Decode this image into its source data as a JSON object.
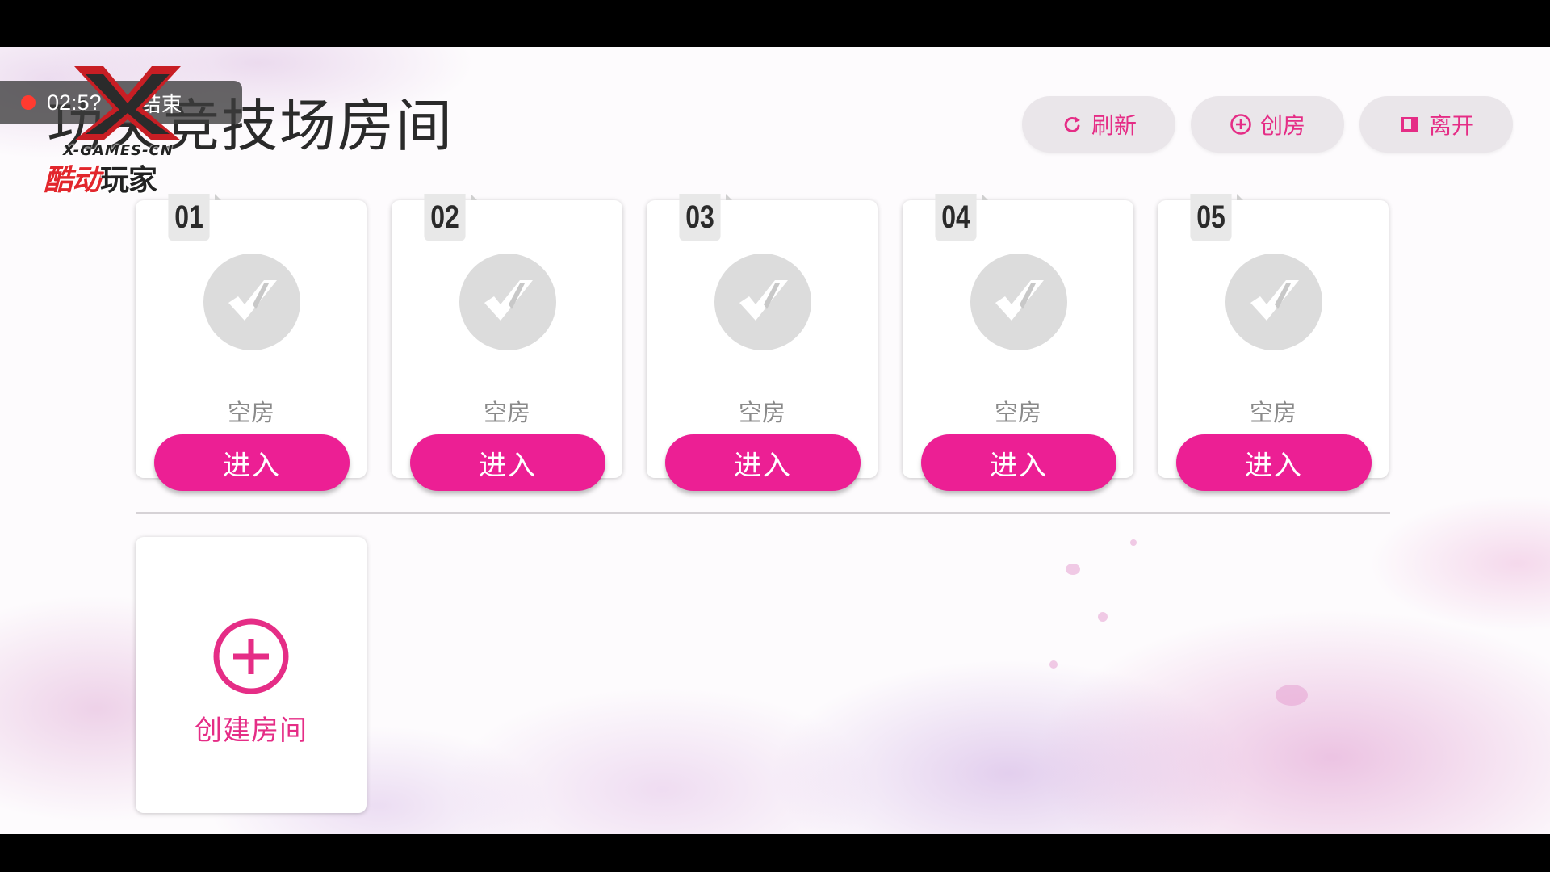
{
  "recorder": {
    "time": "02:5?",
    "end_label": "结束"
  },
  "watermark": {
    "en": "X-GAMES-CN",
    "cn_red": "酷动",
    "cn_black": "玩家"
  },
  "page": {
    "title": "功夫竞技场房间"
  },
  "header_buttons": {
    "refresh": "刷新",
    "create": "创房",
    "leave": "离开"
  },
  "rooms": [
    {
      "number": "01",
      "status": "空房",
      "enter_label": "进入"
    },
    {
      "number": "02",
      "status": "空房",
      "enter_label": "进入"
    },
    {
      "number": "03",
      "status": "空房",
      "enter_label": "进入"
    },
    {
      "number": "04",
      "status": "空房",
      "enter_label": "进入"
    },
    {
      "number": "05",
      "status": "空房",
      "enter_label": "进入"
    }
  ],
  "create_room": {
    "label": "创建房间"
  },
  "colors": {
    "accent": "#ec1f94",
    "accent_text": "#e52d86",
    "button_bg": "#eae6ea",
    "recording_dot": "#ff3b30"
  },
  "icons": {
    "refresh": "refresh-icon",
    "create": "plus-circle-icon",
    "leave": "exit-door-icon",
    "room_avatar": "empty-room-check-icon"
  }
}
